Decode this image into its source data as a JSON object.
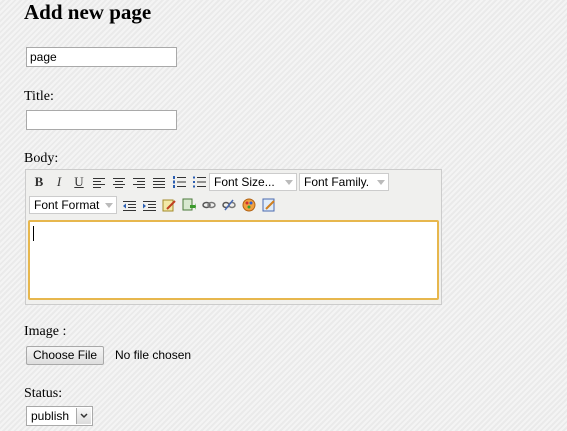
{
  "page": {
    "heading": "Add new page"
  },
  "slug_field": {
    "value": "page"
  },
  "title_field": {
    "label": "Title:",
    "value": ""
  },
  "body_field": {
    "label": "Body:",
    "toolbar": {
      "bold": "B",
      "italic": "I",
      "underline": "U",
      "font_size": "Font Size...",
      "font_family": "Font Family.",
      "font_format": "Font Format"
    }
  },
  "image_field": {
    "label": "Image :",
    "button": "Choose File",
    "status": "No file chosen"
  },
  "status_field": {
    "label": "Status:",
    "selected": "publish"
  },
  "icons": [
    "align-left-icon",
    "align-center-icon",
    "align-right-icon",
    "justify-icon",
    "numbered-list-icon",
    "bullet-list-icon",
    "outdent-icon",
    "indent-icon",
    "edit-icon",
    "insert-icon",
    "link-icon",
    "unlink-icon",
    "color-icon",
    "image-edit-icon"
  ]
}
